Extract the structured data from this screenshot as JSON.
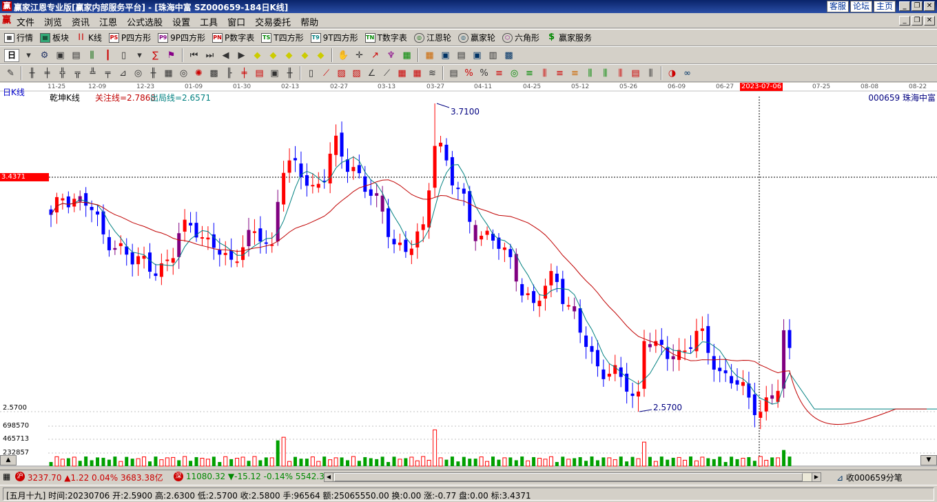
{
  "window": {
    "title": "赢家江恩专业版[赢家内部服务平台] - [珠海中富  SZ000659-184日K线]",
    "links": [
      "客服",
      "论坛",
      "主页"
    ]
  },
  "menu": [
    "文件",
    "浏览",
    "资讯",
    "江恩",
    "公式选股",
    "设置",
    "工具",
    "窗口",
    "交易委托",
    "帮助"
  ],
  "toolbar1": [
    {
      "icon": "table-icon",
      "label": "行情"
    },
    {
      "icon": "blocks-icon",
      "label": "板块"
    },
    {
      "icon": "candle-icon",
      "label": "K线"
    },
    {
      "icon": "p-square-icon",
      "tag": "PS",
      "label": "P四方形"
    },
    {
      "icon": "p9-square-icon",
      "tag": "P9",
      "label": "9P四方形"
    },
    {
      "icon": "pn-table-icon",
      "tag": "PN",
      "label": "P数字表"
    },
    {
      "icon": "t-square-icon",
      "tag": "TS",
      "label": "T四方形"
    },
    {
      "icon": "t9-square-icon",
      "tag": "T9",
      "label": "9T四方形"
    },
    {
      "icon": "tn-table-icon",
      "tag": "TN",
      "label": "T数字表"
    },
    {
      "icon": "gann-wheel-icon",
      "label": "江恩轮"
    },
    {
      "icon": "winner-wheel-icon",
      "label": "赢家轮"
    },
    {
      "icon": "hexagon-icon",
      "label": "六角形"
    },
    {
      "icon": "dollar-icon",
      "label": "赢家服务"
    }
  ],
  "period_selector": "日",
  "chart": {
    "period_label": "日K线",
    "indicator_name": "乾坤K线",
    "indicator_values": {
      "watch_label": "关注线=2.7868",
      "exit_label": "出局线=2.6571"
    },
    "stock_label": "000659  珠海中富",
    "high_label": "3.7100",
    "low_label": "2.5700",
    "price_cursor": "3.4371",
    "axis_low": "2.5700",
    "cursor_date": "2023-07-06",
    "date_ticks": [
      "11-25",
      "12-09",
      "12-23",
      "01-09",
      "01-30",
      "02-13",
      "02-27",
      "03-13",
      "03-27",
      "04-11",
      "04-25",
      "05-12",
      "05-26",
      "06-09",
      "06-27",
      "07-25",
      "08-08",
      "08-22"
    ],
    "volume_ticks": [
      "698570",
      "465713",
      "232857"
    ]
  },
  "chart_data": {
    "type": "candlestick",
    "series": [
      {
        "name": "乾坤K线"
      },
      {
        "name": "关注线"
      },
      {
        "name": "出局线"
      }
    ],
    "high": 3.71,
    "low": 2.57,
    "volume_ticks": [
      698570,
      465713,
      232857
    ]
  },
  "indexbar": {
    "sh_badge": "沪",
    "sh_text": "3237.70 ▲1.22 0.04% 3683.38亿",
    "sz_badge": "深",
    "sz_text": "11080.32 ▼-15.12 -0.14% 5542.3",
    "right_text": "收000659分笔"
  },
  "statusbar": {
    "text": "[五月十九] 时间:20230706 开:2.5900 高:2.6300 低:2.5700 收:2.5800 手:96564 额:25065550.00 换:0.00 涨:-0.77 盘:0.00 标:3.4371"
  },
  "colors": {
    "up": "#ff0000",
    "down": "#0000ff",
    "purple": "#800080",
    "vol_down": "#00a000",
    "ma_fast": "#008080",
    "ma_slow": "#c00000"
  }
}
